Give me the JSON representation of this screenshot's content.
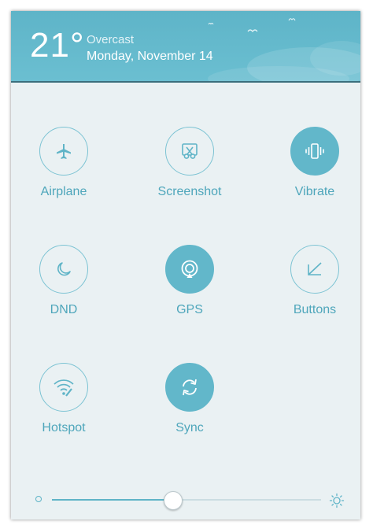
{
  "weather": {
    "temperature": "21°",
    "condition": "Overcast",
    "date": "Monday, November 14"
  },
  "toggles": [
    {
      "label": "Airplane",
      "icon": "airplane-icon",
      "active": false
    },
    {
      "label": "Screenshot",
      "icon": "scissors-icon",
      "active": false
    },
    {
      "label": "Vibrate",
      "icon": "vibrate-icon",
      "active": true
    },
    {
      "label": "DND",
      "icon": "moon-icon",
      "active": false
    },
    {
      "label": "GPS",
      "icon": "gps-icon",
      "active": true
    },
    {
      "label": "Buttons",
      "icon": "buttons-icon",
      "active": false
    },
    {
      "label": "Hotspot",
      "icon": "hotspot-icon",
      "active": false
    },
    {
      "label": "Sync",
      "icon": "sync-icon",
      "active": true
    }
  ],
  "brightness": {
    "level": 0.45
  },
  "colors": {
    "accent": "#62b7ca",
    "header": "#66bbcd",
    "background": "#eaf1f3",
    "label": "#4ea6bb"
  }
}
